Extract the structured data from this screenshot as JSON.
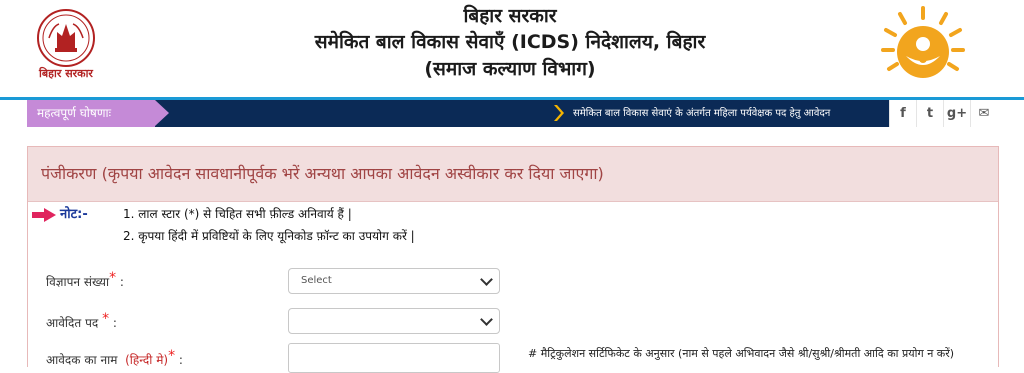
{
  "header": {
    "left_logo_caption": "बिहार सरकार",
    "title_line1": "बिहार सरकार",
    "title_line2": "समेकित बाल विकास सेवाएँ (ICDS) निदेशालय, बिहार",
    "title_line3": "(समाज कल्याण विभाग)"
  },
  "announcement": {
    "label": "महत्वपूर्ण घोषणाः",
    "marquee_text": "समेकित बाल विकास सेवाएं के अंतर्गत महिला पर्यवेक्षक पद हेतु आवेदन",
    "social_icons": [
      "facebook-icon",
      "twitter-icon",
      "google-plus-icon",
      "mail-icon"
    ],
    "social_glyphs": [
      "f",
      "t",
      "g+",
      "✉"
    ]
  },
  "panel": {
    "title": "पंजीकरण (कृपया आवेदन सावधानीपूर्वक भरें अन्यथा आपका आवेदन अस्वीकार कर दिया जाएगा)",
    "note_label": "नोट:-",
    "note_1": "1. लाल स्टार (*) से चिहित सभी फ़ील्ड अनिवार्य हैं |",
    "note_2": "2. कृपया हिंदी में प्रविष्टियों के लिए यूनिकोड फ़ॉन्ट का उपयोग करें |"
  },
  "form": {
    "advert_label": "विज्ञापन संख्या",
    "advert_select_value": "Select",
    "post_label": "आवेदित पद",
    "post_select_value": "",
    "name_label": "आवेदक का नाम",
    "name_label_hindi": "(हिन्दी मे)",
    "required_star": "*",
    "colon": ":",
    "name_hint": "# मैट्रिकुलेशन सर्टिफिकेट के अनुसार (नाम से पहले अभिवादन जैसे श्री/सुश्री/श्रीमती आदि का प्रयोग न करें)"
  },
  "colors": {
    "announce_bg": "#0b2a56",
    "announce_label_bg": "#c58ad7",
    "panel_head_bg": "#f2dede",
    "panel_title": "#a04444",
    "accent_blue": "#1a9ad6",
    "required_red": "#e22222"
  }
}
